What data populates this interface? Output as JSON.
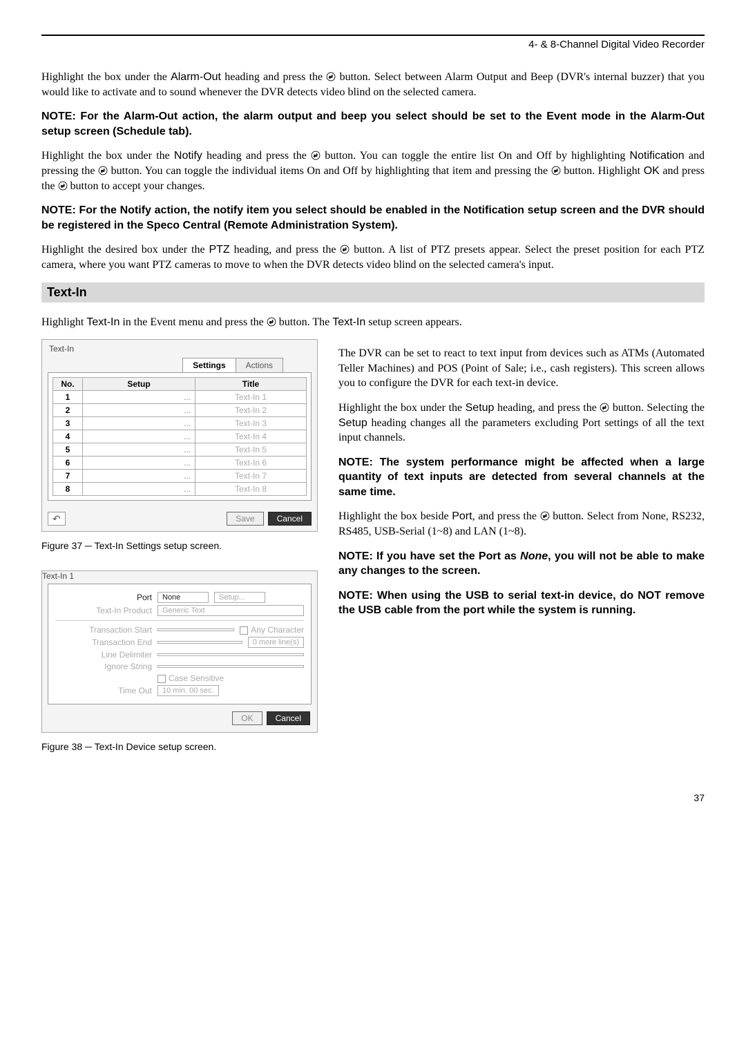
{
  "header": {
    "doc_title": "4- & 8-Channel Digital Video Recorder"
  },
  "body": {
    "p1a": "Highlight the box under the ",
    "p1_alarmout": "Alarm-Out",
    "p1b": " heading and press the ",
    "p1c": " button.  Select between Alarm Output and Beep (DVR's internal buzzer) that you would like to activate and to sound whenever the DVR detects video blind on the selected camera.",
    "note1": "NOTE:  For the Alarm-Out action, the alarm output and beep you select should be set to the Event mode in the Alarm-Out setup screen (Schedule tab).",
    "p2a": "Highlight the box under the ",
    "p2_notify": "Notify",
    "p2b": " heading and press the ",
    "p2c": " button.  You can toggle the entire list On and Off by highlighting ",
    "p2_notification": "Notification",
    "p2d": " and pressing the ",
    "p2e": " button.  You can toggle the individual items On and Off by highlighting that item and pressing the ",
    "p2f": " button.  Highlight ",
    "p2_ok": "OK",
    "p2g": " and press the ",
    "p2h": " button to accept your changes.",
    "note2": "NOTE:  For the Notify action, the notify item you select should be enabled in the Notification setup screen and the DVR should be registered in the Speco Central (Remote Administration System).",
    "p3a": "Highlight the desired box under the ",
    "p3_ptz": "PTZ",
    "p3b": " heading, and press the ",
    "p3c": " button.  A list of PTZ presets appear.  Select the preset position for each PTZ camera, where you want PTZ cameras to move to when the DVR detects video blind on the selected camera's input.",
    "section_textin": "Text-In",
    "p4a": "Highlight ",
    "p4_textin": "Text-In",
    "p4b": " in the Event menu and press the ",
    "p4c": " button.  The ",
    "p4_textin2": "Text-In",
    "p4d": " setup screen appears.",
    "right1": "The DVR can be set to react to text input from devices such as ATMs (Automated Teller Machines) and POS (Point of Sale; i.e., cash registers).  This screen allows you to configure the DVR for each text-in device.",
    "right2a": "Highlight the box under the ",
    "right2_setup": "Setup",
    "right2b": " heading, and press the ",
    "right2c": " button.  Selecting the ",
    "right2_setup2": "Setup",
    "right2d": " heading changes all the parameters excluding Port settings of all the text input channels.",
    "note3": "NOTE:  The system performance might be affected when a large quantity of text inputs are detected from several channels at the same time.",
    "right3a": "Highlight the box beside ",
    "right3_port": "Port",
    "right3b": ", and press the ",
    "right3c": " button.  Select from None, RS232, RS485, USB-Serial (1~8) and LAN (1~8).",
    "note4a": "NOTE:  If you have set the Port as ",
    "note4_none": "None",
    "note4b": ", you will not be able to make any changes to the screen.",
    "note5": "NOTE:  When using the USB to serial text-in device, do NOT remove the USB cable from the port while the system is running."
  },
  "fig37": {
    "window_title": "Text-In",
    "tabs": {
      "settings": "Settings",
      "actions": "Actions"
    },
    "headers": {
      "no": "No.",
      "setup": "Setup",
      "title": "Title"
    },
    "rows": [
      {
        "no": "1",
        "setup": "...",
        "title": "Text-In 1"
      },
      {
        "no": "2",
        "setup": "...",
        "title": "Text-In 2"
      },
      {
        "no": "3",
        "setup": "...",
        "title": "Text-In 3"
      },
      {
        "no": "4",
        "setup": "...",
        "title": "Text-In 4"
      },
      {
        "no": "5",
        "setup": "...",
        "title": "Text-In 5"
      },
      {
        "no": "6",
        "setup": "...",
        "title": "Text-In 6"
      },
      {
        "no": "7",
        "setup": "...",
        "title": "Text-In 7"
      },
      {
        "no": "8",
        "setup": "...",
        "title": "Text-In 8"
      }
    ],
    "buttons": {
      "save": "Save",
      "cancel": "Cancel"
    },
    "caption": "Figure 37 ─ Text-In Settings setup screen."
  },
  "fig38": {
    "window_title": "Text-In 1",
    "labels": {
      "port": "Port",
      "product": "Text-In Product",
      "tstart": "Transaction Start",
      "tend": "Transaction End",
      "delim": "Line Delimiter",
      "ignore": "Ignore String",
      "timeout": "Time Out"
    },
    "values": {
      "port": "None",
      "setup_btn": "Setup...",
      "product": "Generic Text",
      "anychar": "Any Character",
      "moreline": "0 more line(s)",
      "casesens": "Case Sensitive",
      "timeout": "10 min. 00 sec."
    },
    "buttons": {
      "ok": "OK",
      "cancel": "Cancel"
    },
    "caption": "Figure 38 ─ Text-In Device setup screen."
  },
  "page_number": "37"
}
